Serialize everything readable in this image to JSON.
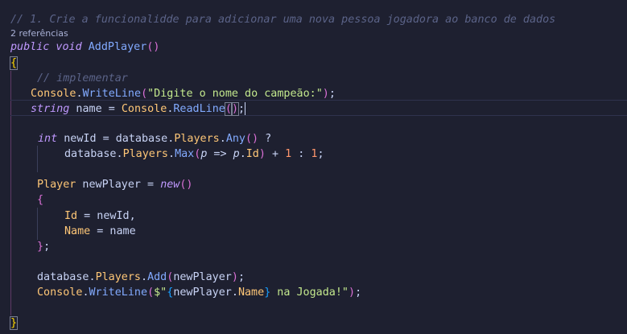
{
  "editor": {
    "header_comment": "// 1. Crie a funcionalidde para adicionar uma nova pessoa jogadora ao banco de dados",
    "codelens": "2 referências",
    "sig": {
      "mods": "public void",
      "name": "AddPlayer",
      "parens": "()"
    },
    "open_brace": "{",
    "close_brace": "}",
    "todo_comment": "// implementar",
    "l1": {
      "cls": "Console",
      "dot": ".",
      "fn": "WriteLine",
      "po": "(",
      "str": "\"Digite o nome do campeão:\"",
      "pc": ")",
      "semi": ";"
    },
    "l2": {
      "kw": "string",
      "var": " name = ",
      "cls": "Console",
      "dot": ".",
      "fn": "ReadLine",
      "po": "(",
      "pc": ")",
      "semi": ";"
    },
    "l3": {
      "kw": "int",
      "var": " newId = database.",
      "prop": "Players",
      "dot": ".",
      "fn": "Any",
      "parens": "()",
      "op": " ?"
    },
    "l4": {
      "var": "database.",
      "prop": "Players",
      "dot": ".",
      "fn": "Max",
      "po": "(",
      "param": "p",
      "arrow": " => ",
      "param2": "p",
      "dot2": ".",
      "prop2": "Id",
      "pc": ")",
      "plus": " + ",
      "num1": "1",
      "colon": " : ",
      "num2": "1",
      "semi": ";"
    },
    "l5": {
      "cls": "Player",
      "var": " newPlayer = ",
      "kw": "new",
      "parens": "()"
    },
    "l6": {
      "brace": "{"
    },
    "l7": {
      "prop": "Id",
      "rest": " = newId,"
    },
    "l8": {
      "prop": "Name",
      "rest": " = name"
    },
    "l9": {
      "brace": "}",
      "semi": ";"
    },
    "l10": {
      "var": "database.",
      "prop": "Players",
      "dot": ".",
      "fn": "Add",
      "po": "(",
      "arg": "newPlayer",
      "pc": ")",
      "semi": ";"
    },
    "l11": {
      "cls": "Console",
      "dot": ".",
      "fn": "WriteLine",
      "po": "(",
      "s1": "$\"",
      "ib_open": "{",
      "iv": "newPlayer.",
      "ip": "Name",
      "ib_close": "}",
      "s2": " na Jogada!\"",
      "pc": ")",
      "semi": ";"
    }
  }
}
